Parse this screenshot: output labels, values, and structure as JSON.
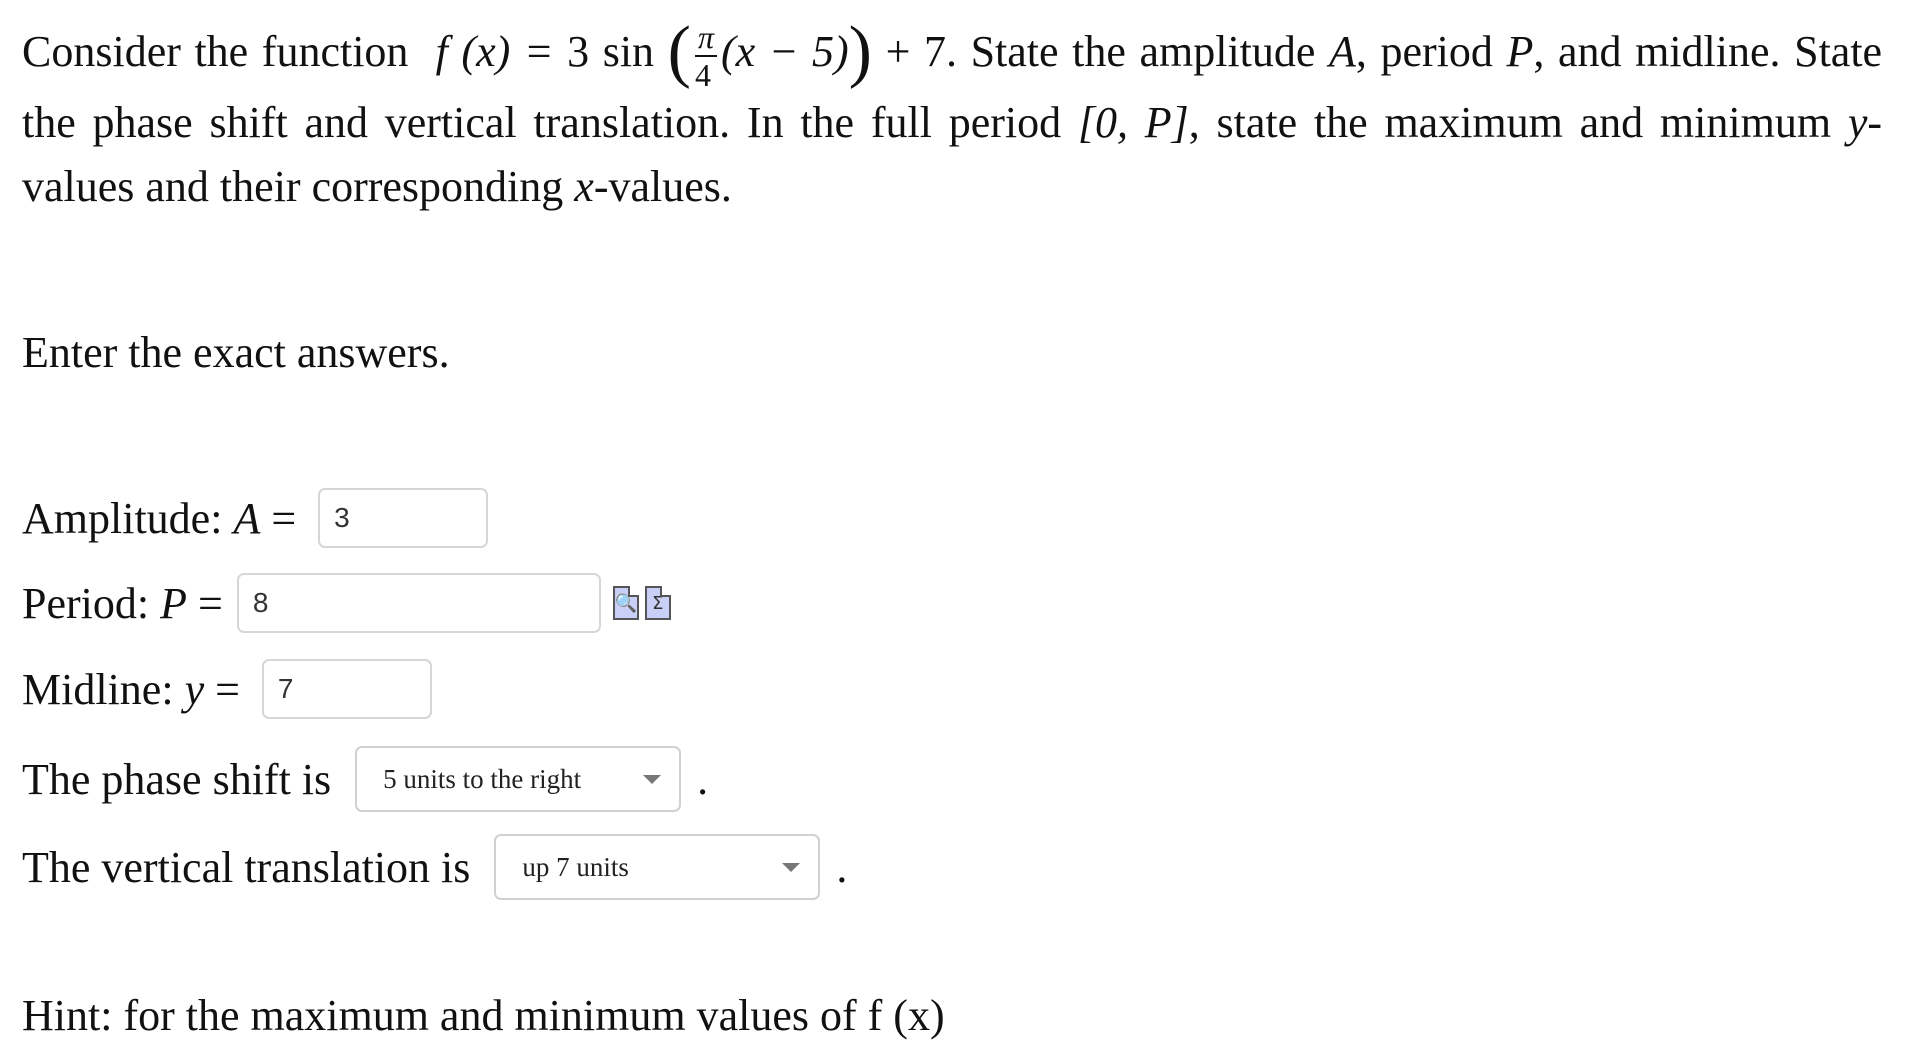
{
  "problem": {
    "intro": "Consider the function",
    "function_lhs": "f (x) = ",
    "coef": "3 sin",
    "frac_num": "π",
    "frac_den": "4",
    "inner": "(x − 5)",
    "tail": "+ 7.",
    "sentence1_rest": "State the amplitude",
    "var_A": "A",
    "period_word": ", period",
    "var_P": "P",
    "and_midline": ", and midline. State the phase shift and vertical translation. In the full period",
    "interval": "[0, P]",
    "rest": ", state the maximum and minimum",
    "var_y": "y",
    "rest2": "-values and their corresponding",
    "var_x": "x",
    "rest3": "-values."
  },
  "instruction": "Enter the exact answers.",
  "fields": {
    "amplitude": {
      "label": "Amplitude:",
      "var": "A",
      "eq": "=",
      "value": "3"
    },
    "period": {
      "label": "Period:",
      "var": "P",
      "eq": "=",
      "value": "8"
    },
    "midline": {
      "label": "Midline:",
      "var": "y",
      "eq": "=",
      "value": "7"
    }
  },
  "icons": [
    "preview-icon",
    "equation-editor-icon"
  ],
  "phase_shift": {
    "label": "The phase shift is",
    "selected": "5 units to the right",
    "end": "."
  },
  "vertical_translation": {
    "label": "The vertical translation is",
    "selected": "up 7 units",
    "end": "."
  },
  "hint_partial": "Hint: for the maximum and minimum values of f (x)"
}
